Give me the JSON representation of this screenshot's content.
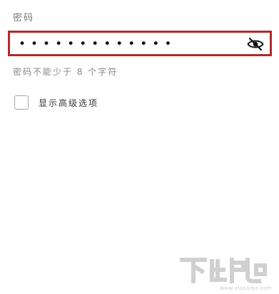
{
  "password_field": {
    "label": "密码",
    "value": "•••••••••••••",
    "visibility_icon": "eye-off-icon",
    "helper": "密码不能少于 8 个字符",
    "highlight_color": "#b22a2a"
  },
  "advanced_option": {
    "label": "显示高级选项",
    "checked": false
  },
  "watermark": {
    "brand": "下载吧",
    "url": "www.xiazaiba.com"
  }
}
